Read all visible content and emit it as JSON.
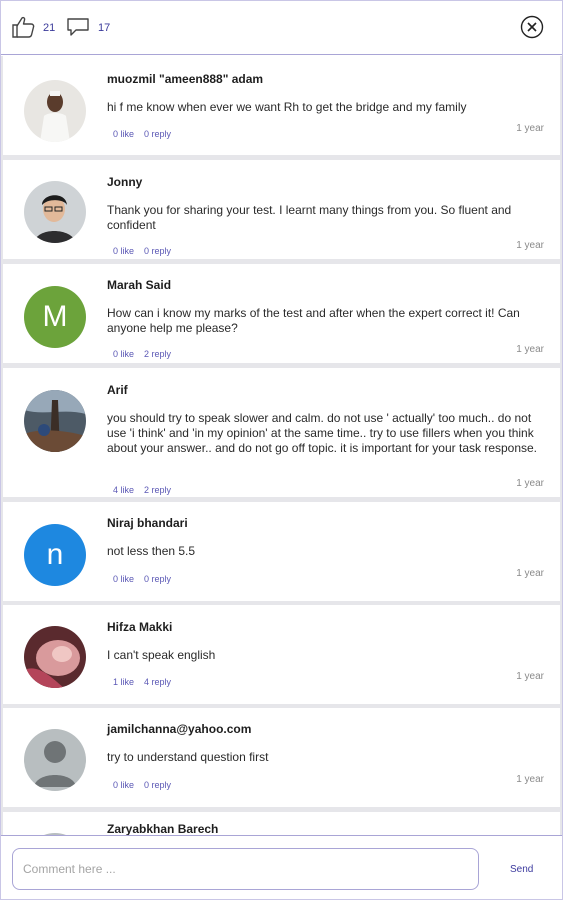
{
  "header": {
    "likes_count": "21",
    "comments_count": "17"
  },
  "comments": [
    {
      "name": "muozmil \"ameen888\" adam",
      "text": "hi f me know when ever we want Rh to get the bridge and my family",
      "likes": "0 like",
      "replies": "0 reply",
      "time": "1 year",
      "avatar": "photo"
    },
    {
      "name": "Jonny",
      "text": "Thank you for sharing your test. I learnt many things from you. So fluent and confident",
      "likes": "0 like",
      "replies": "0 reply",
      "time": "1 year",
      "avatar": "photo"
    },
    {
      "name": "Marah Said",
      "text": "How can i know my marks  of the test and after when the expert correct it! Can anyone help me please?",
      "likes": "0 like",
      "replies": "2 reply",
      "time": "1 year",
      "avatar": "letter",
      "avatar_letter": "M",
      "avatar_color": "#6ca33b"
    },
    {
      "name": "Arif",
      "text": "you should try to speak slower and calm. do not use ' actually' too much.. do not use 'i think' and 'in my opinion' at the same time.. try to use fillers when you think about your answer.. and do not go off topic. it is important for your task response.",
      "likes": "4 like",
      "replies": "2 reply",
      "time": "1 year",
      "avatar": "photo"
    },
    {
      "name": "Niraj bhandari",
      "text": "not less then 5.5",
      "likes": "0 like",
      "replies": "0 reply",
      "time": "1 year",
      "avatar": "letter",
      "avatar_letter": "n",
      "avatar_color": "#1e88e0"
    },
    {
      "name": "Hifza Makki",
      "text": "I can't speak english",
      "likes": "1 like",
      "replies": "4 reply",
      "time": "1 year",
      "avatar": "photo"
    },
    {
      "name": "jamilchanna@yahoo.com",
      "text": "try to understand question first",
      "likes": "0 like",
      "replies": "0 reply",
      "time": "1 year",
      "avatar": "default"
    },
    {
      "name": "Zaryabkhan Barech",
      "text": "",
      "likes": "",
      "replies": "",
      "time": "",
      "avatar": "default"
    }
  ],
  "footer": {
    "placeholder": "Comment here ...",
    "send_label": "Send"
  },
  "colors": {
    "accent": "#3c3a9e",
    "border": "#a9a5d6",
    "separator": "#e6e6ea"
  },
  "icons": {
    "like": "thumbs-up-icon",
    "comment": "speech-bubble-icon",
    "close": "close-circle-icon"
  }
}
